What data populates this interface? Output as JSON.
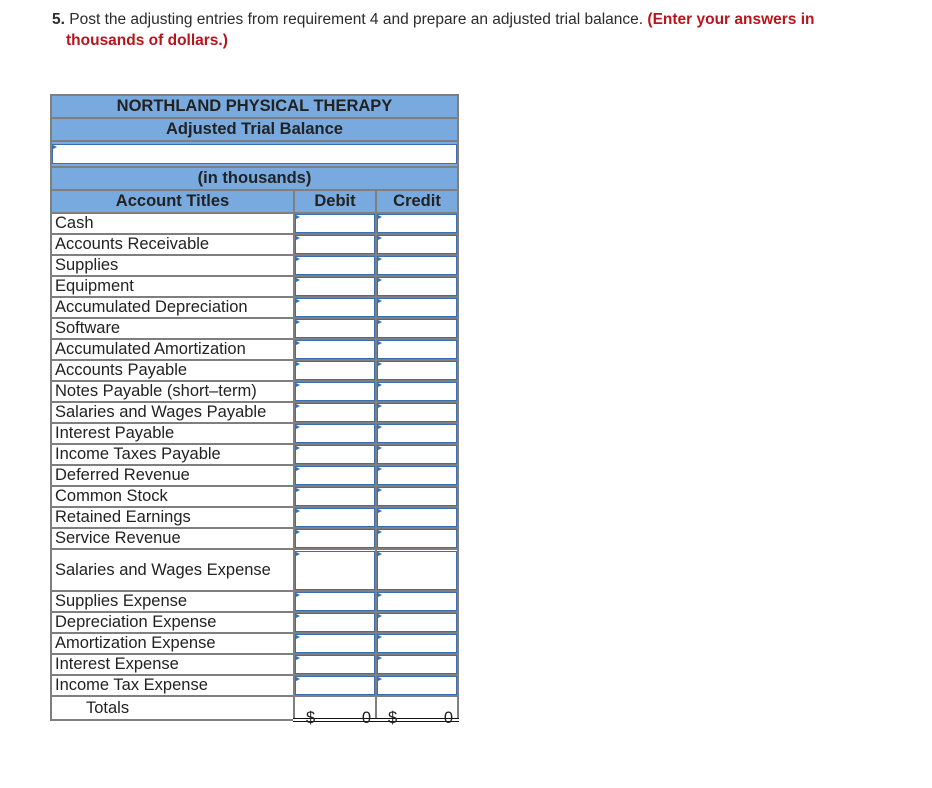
{
  "question": {
    "number": "5.",
    "text": "Post the adjusting entries from requirement 4 and prepare an adjusted trial balance.",
    "note_line1": "(Enter your answers in",
    "note_line2": "thousands of dollars.)"
  },
  "colors": {
    "header_bg": "#78aadf",
    "note_red": "#b8141c",
    "input_border": "#3a6fb0"
  },
  "table": {
    "company": "NORTHLAND PHYSICAL THERAPY",
    "title": "Adjusted Trial Balance",
    "date_value": "",
    "units": "(in thousands)",
    "columns": {
      "account": "Account Titles",
      "debit": "Debit",
      "credit": "Credit"
    },
    "rows": [
      {
        "account": "Cash",
        "debit": "",
        "credit": ""
      },
      {
        "account": "Accounts Receivable",
        "debit": "",
        "credit": ""
      },
      {
        "account": "Supplies",
        "debit": "",
        "credit": ""
      },
      {
        "account": "Equipment",
        "debit": "",
        "credit": ""
      },
      {
        "account": "Accumulated Depreciation",
        "debit": "",
        "credit": ""
      },
      {
        "account": "Software",
        "debit": "",
        "credit": ""
      },
      {
        "account": "Accumulated Amortization",
        "debit": "",
        "credit": ""
      },
      {
        "account": "Accounts Payable",
        "debit": "",
        "credit": ""
      },
      {
        "account": "Notes Payable (short–term)",
        "debit": "",
        "credit": ""
      },
      {
        "account": "Salaries and Wages Payable",
        "debit": "",
        "credit": ""
      },
      {
        "account": "Interest Payable",
        "debit": "",
        "credit": ""
      },
      {
        "account": "Income Taxes Payable",
        "debit": "",
        "credit": ""
      },
      {
        "account": "Deferred Revenue",
        "debit": "",
        "credit": ""
      },
      {
        "account": "Common Stock",
        "debit": "",
        "credit": ""
      },
      {
        "account": "Retained Earnings",
        "debit": "",
        "credit": ""
      },
      {
        "account": "Service Revenue",
        "debit": "",
        "credit": ""
      },
      {
        "account": "Salaries and Wages Expense",
        "debit": "",
        "credit": "",
        "wrap": true
      },
      {
        "account": "Supplies Expense",
        "debit": "",
        "credit": ""
      },
      {
        "account": "Depreciation Expense",
        "debit": "",
        "credit": ""
      },
      {
        "account": "Amortization Expense",
        "debit": "",
        "credit": ""
      },
      {
        "account": "Interest Expense",
        "debit": "",
        "credit": ""
      },
      {
        "account": "Income Tax Expense",
        "debit": "",
        "credit": ""
      }
    ],
    "totals": {
      "label": "Totals",
      "currency": "$",
      "debit": "0",
      "credit": "0"
    }
  }
}
